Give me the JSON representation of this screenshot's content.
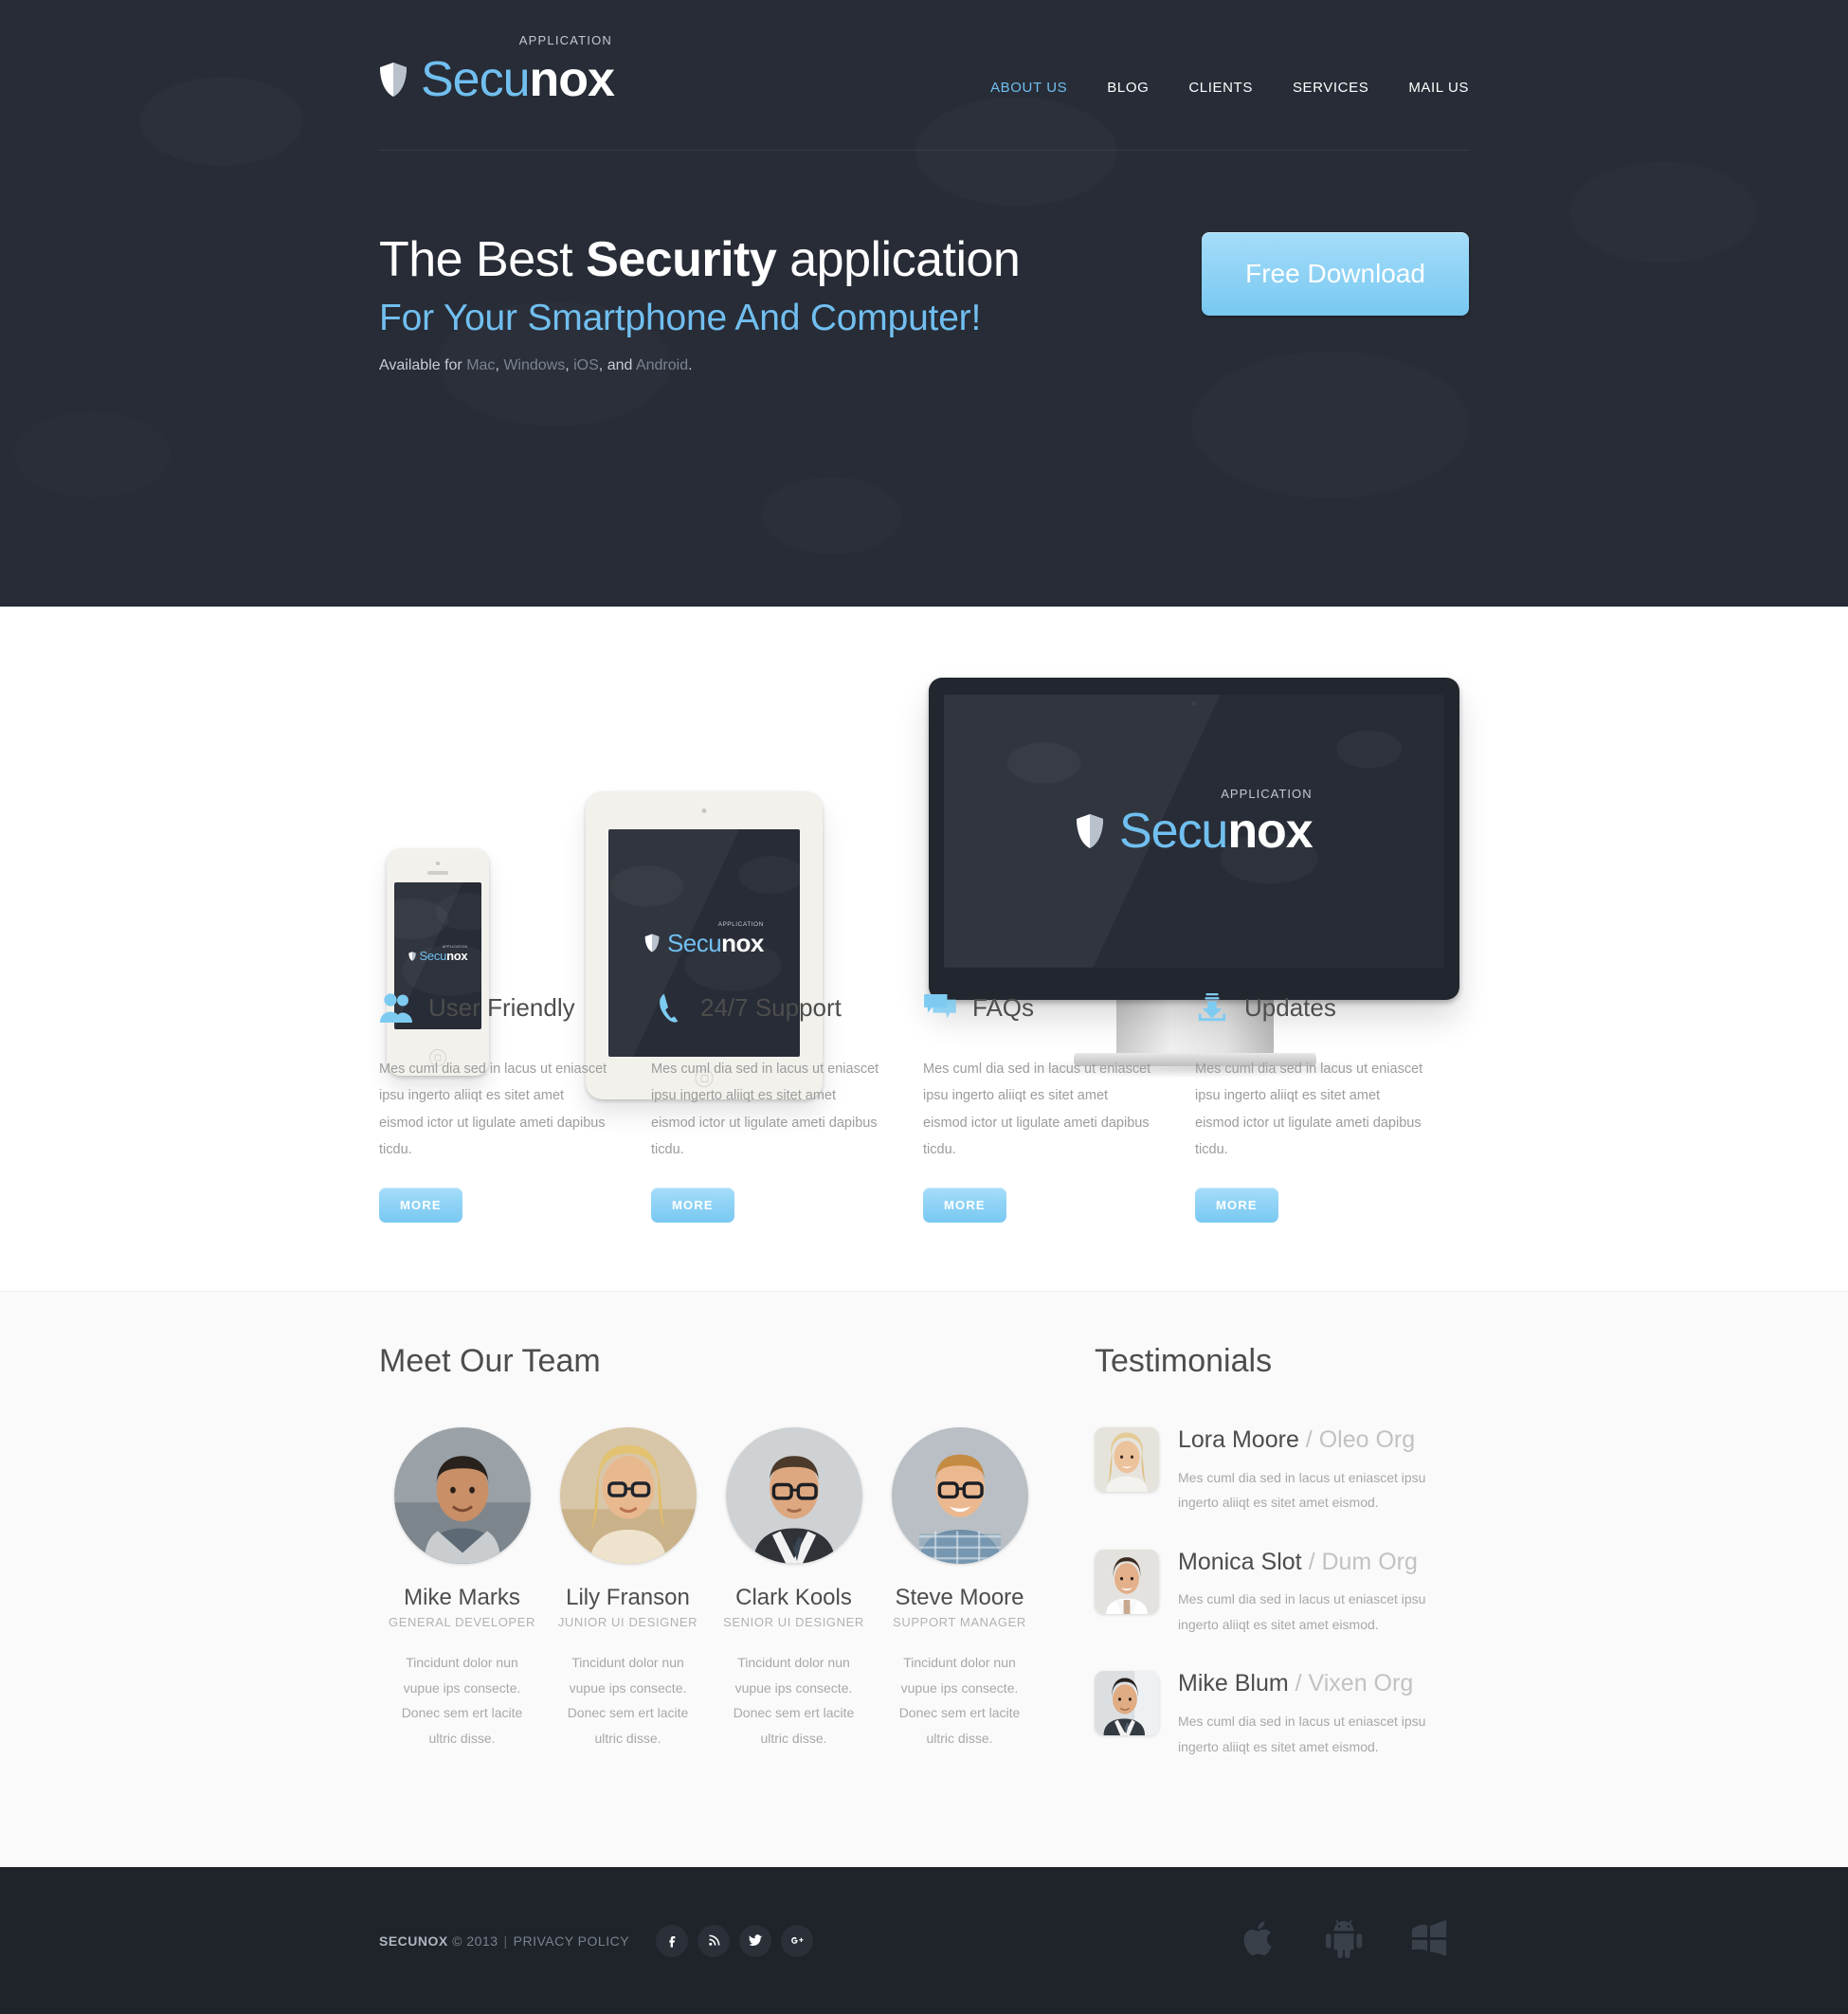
{
  "brand": {
    "logo_shield_icon": "shield-icon",
    "name_part1": "Secu",
    "name_part2": "nox",
    "superscript": "APPLICATION",
    "accent_color": "#71bff0",
    "dark_color": "#272c36"
  },
  "nav": {
    "items": [
      {
        "label": "ABOUT US",
        "active": true
      },
      {
        "label": "BLOG",
        "active": false
      },
      {
        "label": "CLIENTS",
        "active": false
      },
      {
        "label": "SERVICES",
        "active": false
      },
      {
        "label": "MAIL US",
        "active": false
      }
    ]
  },
  "hero": {
    "title_pre": "The Best ",
    "title_bold": "Security",
    "title_post": " application",
    "subtitle": "For Your Smartphone And Computer!",
    "availability_prefix": "Available for ",
    "platform_mac": "Mac",
    "sep1": ", ",
    "platform_windows": "Windows",
    "sep2": ", ",
    "platform_ios": "iOS",
    "sep3": ", and ",
    "platform_android": "Android",
    "sep4": ".",
    "cta_label": "Free Download"
  },
  "features": {
    "more_label": "MORE",
    "items": [
      {
        "icon": "users-icon",
        "title": "User Friendly",
        "body": "Mes cuml dia sed in lacus ut eniascet ipsu ingerto aliiqt es sitet amet eismod ictor ut ligulate ameti dapibus ticdu."
      },
      {
        "icon": "phone-icon",
        "title": "24/7 Support",
        "body": "Mes cuml dia sed in lacus ut eniascet ipsu ingerto aliiqt es sitet amet eismod ictor ut ligulate ameti dapibus ticdu."
      },
      {
        "icon": "chat-bubbles-icon",
        "title": "FAQs",
        "body": "Mes cuml dia sed in lacus ut eniascet ipsu ingerto aliiqt es sitet amet eismod ictor ut ligulate ameti dapibus ticdu."
      },
      {
        "icon": "download-icon",
        "title": "Updates",
        "body": "Mes cuml dia sed in lacus ut eniascet ipsu ingerto aliiqt es sitet amet eismod ictor ut ligulate ameti dapibus ticdu."
      }
    ]
  },
  "team": {
    "title": "Meet Our Team",
    "members": [
      {
        "name": "Mike Marks",
        "role": "GENERAL DEVELOPER",
        "bio": "Tincidunt dolor nun vupue ips consecte. Donec sem ert lacite ultric disse."
      },
      {
        "name": "Lily Franson",
        "role": "JUNIOR UI DESIGNER",
        "bio": "Tincidunt dolor nun vupue ips consecte. Donec sem ert lacite ultric disse."
      },
      {
        "name": "Clark Kools",
        "role": "SENIOR UI DESIGNER",
        "bio": "Tincidunt dolor nun vupue ips consecte. Donec sem ert lacite ultric disse."
      },
      {
        "name": "Steve Moore",
        "role": "SUPPORT MANAGER",
        "bio": "Tincidunt dolor nun vupue ips consecte. Donec sem ert lacite ultric disse."
      }
    ]
  },
  "testimonials": {
    "title": "Testimonials",
    "items": [
      {
        "name": "Lora Moore",
        "separator": " / ",
        "org": "Oleo Org",
        "text": "Mes cuml dia sed in lacus ut eniascet ipsu ingerto aliiqt es sitet amet eismod."
      },
      {
        "name": "Monica Slot",
        "separator": " / ",
        "org": "Dum Org",
        "text": "Mes cuml dia sed in lacus ut eniascet ipsu ingerto aliiqt es sitet amet eismod."
      },
      {
        "name": "Mike Blum",
        "separator": " / ",
        "org": "Vixen Org",
        "text": "Mes cuml dia sed in lacus ut eniascet ipsu ingerto aliiqt es sitet amet eismod."
      }
    ]
  },
  "footer": {
    "brand": "SECUNOX",
    "copyright": "© 2013",
    "separator": "|",
    "privacy": "PRIVACY POLICY",
    "socials": [
      {
        "icon": "facebook-icon",
        "label": "f"
      },
      {
        "icon": "rss-icon",
        "label": "RSS"
      },
      {
        "icon": "twitter-icon",
        "label": "Twitter"
      },
      {
        "icon": "google-plus-icon",
        "label": "g+"
      }
    ],
    "platforms": [
      {
        "icon": "apple-icon",
        "label": "Apple"
      },
      {
        "icon": "android-icon",
        "label": "Android"
      },
      {
        "icon": "windows-icon",
        "label": "Windows"
      }
    ]
  },
  "devices": {
    "phone_label": "smartphone-mockup",
    "tablet_label": "tablet-mockup",
    "monitor_label": "desktop-monitor-mockup"
  }
}
